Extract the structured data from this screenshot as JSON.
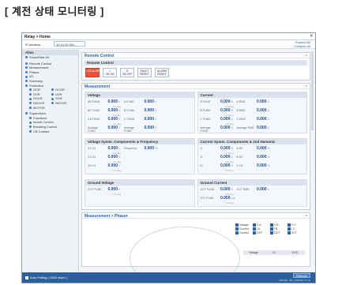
{
  "caption": "[ 계전 상태 모니터링 ]",
  "window": {
    "title": "Relay > Home",
    "close_glyph": "×"
  },
  "ipbar": {
    "label": "IP Address",
    "value": "10.10.20.251",
    "expand_all": "Expand All",
    "collapse_all": "Collapse All"
  },
  "sidebar": {
    "header": "Alias",
    "show_hide": "Show/Hide All",
    "items": [
      "Remote Control",
      "Measurement",
      "Phasor",
      "I/O",
      "Summary",
      "Protection"
    ],
    "protection": [
      [
        "OCR",
        "OCGR"
      ],
      [
        "OVR",
        "UVR"
      ],
      [
        "OVGR",
        "SGR"
      ],
      [
        "NSOCR",
        "NSOVR"
      ],
      [
        "MOTOR",
        ""
      ]
    ],
    "supervision": "Supervision",
    "supervision_items": [
      "Functions",
      "Inrush Current",
      "Breaking Current",
      "CB Contact"
    ]
  },
  "remote_control": {
    "title": "Remote Control",
    "section": "Remote Control",
    "buttons": [
      {
        "label": "LOCAL/REMOTE",
        "state": "active"
      },
      {
        "label": "I\nCB ON",
        "state": "normal"
      },
      {
        "label": "O\nCB OFF",
        "state": "normal"
      },
      {
        "label": "FAULT\nRESET",
        "state": "normal"
      },
      {
        "label": "ALARM\nRESET",
        "state": "normal"
      }
    ]
  },
  "measurement": {
    "title": "Measurement",
    "voltage": {
      "title": "Voltage",
      "rows": [
        {
          "l1": "AB FUND",
          "v1": "0.000",
          "u1": "V",
          "l2": "A FUND",
          "v2": "0.000",
          "u2": "V",
          "deg": "0.0 deg"
        },
        {
          "l1": "BC FUND",
          "v1": "0.000",
          "u1": "V",
          "l2": "B FUND",
          "v2": "0.000",
          "u2": "V",
          "deg": "0.0 deg"
        },
        {
          "l1": "CA FUND",
          "v1": "0.000",
          "u1": "V",
          "l2": "C FUND",
          "v2": "0.000",
          "u2": "V",
          "deg": "0.0 deg"
        },
        {
          "l1": "Average FUND",
          "v1": "0.000",
          "u1": "V",
          "l2": "Average FUND",
          "v2": "0.000",
          "u2": "V",
          "deg": ""
        }
      ]
    },
    "current": {
      "title": "Current",
      "rows": [
        {
          "l1": "A FUND",
          "v1": "0.000",
          "u1": "A",
          "l2": "A RMS",
          "v2": "0.000",
          "u2": "A",
          "deg": "0.0 deg"
        },
        {
          "l1": "B FUND",
          "v1": "0.000",
          "u1": "A",
          "l2": "B RMS",
          "v2": "0.000",
          "u2": "A",
          "deg": "0.0 deg"
        },
        {
          "l1": "C FUND",
          "v1": "0.000",
          "u1": "A",
          "l2": "C RMS",
          "v2": "0.000",
          "u2": "A",
          "deg": "0.0 deg"
        },
        {
          "l1": "Average FUND",
          "v1": "0.000",
          "u1": "A",
          "l2": "Average RMS",
          "v2": "0.000",
          "u2": "A",
          "deg": ""
        }
      ]
    },
    "vsym": {
      "title": "Voltage Symm. Components & Frequency",
      "rows": [
        {
          "l1": "V1 LN",
          "v1": "0.000",
          "u1": "V",
          "l2": "Frequency",
          "v2": "0.000",
          "u2": "Hz",
          "deg": "0.0 deg"
        },
        {
          "l1": "V2 LN",
          "v1": "0.000",
          "u1": "V",
          "l2": "",
          "v2": "",
          "u2": "",
          "deg": "0.0 deg"
        },
        {
          "l1": "V0 LN",
          "v1": "0.000",
          "u1": "V",
          "l2": "",
          "v2": "",
          "u2": "",
          "deg": "0.0 deg"
        }
      ]
    },
    "csym": {
      "title": "Current Symm. Components & 2nd Hamonic",
      "rows": [
        {
          "l1": "I1",
          "v1": "0.000",
          "u1": "A",
          "l2": "A H2",
          "v2": "0.000",
          "u2": "%",
          "deg": "0.0 deg"
        },
        {
          "l1": "I2",
          "v1": "0.000",
          "u1": "A",
          "l2": "B H2",
          "v2": "0.000",
          "u2": "%",
          "deg": "0.0 deg"
        },
        {
          "l1": "I0",
          "v1": "0.000",
          "u1": "A",
          "l2": "C H2",
          "v2": "0.000",
          "u2": "%",
          "deg": "0.0 deg"
        }
      ]
    },
    "gvolt": {
      "title": "Ground Voltage",
      "rows": [
        {
          "l1": "GVT FUND",
          "v1": "0.000",
          "u1": "V",
          "l2": "",
          "v2": "",
          "u2": "",
          "deg": "0.0 deg"
        }
      ]
    },
    "gcurr": {
      "title": "Ground Current",
      "rows": [
        {
          "l1": "GCT FUND",
          "v1": "0.000",
          "u1": "A",
          "l2": "GCT RMS",
          "v2": "0.000",
          "u2": "A",
          "deg": "0.0 deg"
        },
        {
          "l1": "ZCT FUND",
          "v1": "0.000",
          "u1": "mA",
          "l2": "",
          "v2": "",
          "u2": "",
          "deg": "0.0 deg"
        }
      ]
    }
  },
  "phasor": {
    "title": "Measurement > Phasor",
    "legend": [
      "Voltage",
      "V A",
      "V B",
      "V C",
      "Current",
      "I A",
      "I B",
      "I C",
      "Ground",
      "GVT",
      "GCT",
      "ZCT"
    ],
    "bar": [
      "Voltage",
      "V1",
      "V1%"
    ]
  },
  "footer": {
    "auto_polling": "Auto Polling ( 1000 msec )",
    "refresh": "Refresh",
    "stamp": "Refresh : #6 / 13:00:09 / 6 ms"
  }
}
